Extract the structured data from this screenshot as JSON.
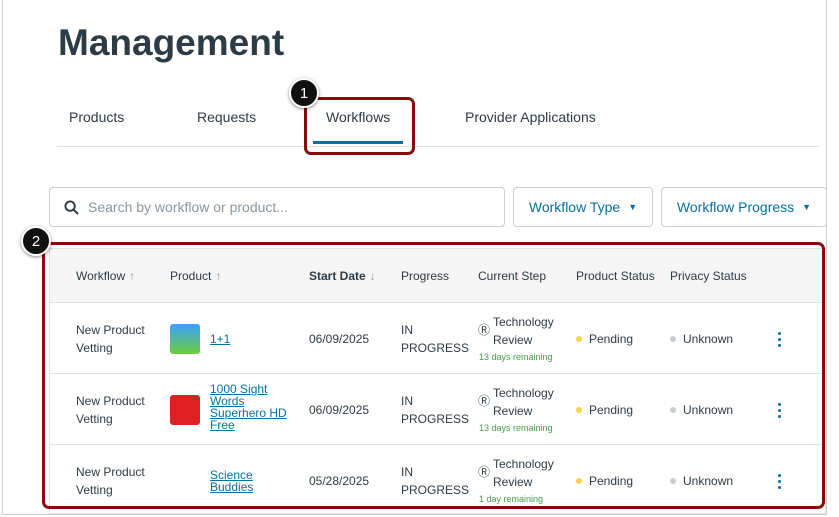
{
  "page": {
    "title": "Management"
  },
  "tabs": [
    {
      "label": "Products"
    },
    {
      "label": "Requests"
    },
    {
      "label": "Workflows"
    },
    {
      "label": "Provider Applications"
    }
  ],
  "search": {
    "placeholder": "Search by workflow or product..."
  },
  "filters": {
    "workflow_type": "Workflow Type",
    "workflow_progress": "Workflow Progress"
  },
  "table": {
    "columns": [
      "Workflow",
      "Product",
      "Start Date",
      "Progress",
      "Current Step",
      "Product Status",
      "Privacy Status"
    ],
    "rows": [
      {
        "workflow": "New Product Vetting",
        "product": "1+1",
        "start_date": "06/09/2025",
        "progress": "IN PROGRESS",
        "step": "Technology Review",
        "remaining": "13 days remaining",
        "product_status": "Pending",
        "privacy_status": "Unknown"
      },
      {
        "workflow": "New Product Vetting",
        "product": "1000 Sight Words Superhero HD Free",
        "start_date": "06/09/2025",
        "progress": "IN PROGRESS",
        "step": "Technology Review",
        "remaining": "13 days remaining",
        "product_status": "Pending",
        "privacy_status": "Unknown"
      },
      {
        "workflow": "New Product Vetting",
        "product": "Science Buddies",
        "start_date": "05/28/2025",
        "progress": "IN PROGRESS",
        "step": "Technology Review",
        "remaining": "1 day remaining",
        "product_status": "Pending",
        "privacy_status": "Unknown"
      }
    ]
  },
  "annotations": {
    "one": "1",
    "two": "2"
  },
  "colors": {
    "accent": "#0770a3",
    "pending": "#fcd34d",
    "unknown": "#c7cdd1",
    "highlight": "#8b0a0a"
  }
}
